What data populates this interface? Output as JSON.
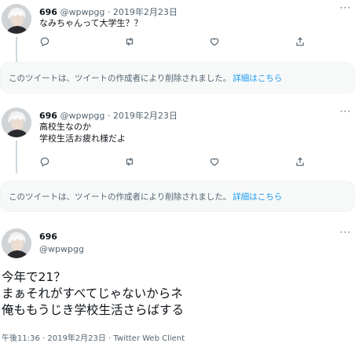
{
  "tweets": [
    {
      "name": "696",
      "handle": "@wpwpgg",
      "dot": "·",
      "date": "2019年2月23日",
      "lines": [
        "なみちゃんって大学生？？"
      ]
    },
    {
      "name": "696",
      "handle": "@wpwpgg",
      "dot": "·",
      "date": "2019年2月23日",
      "lines": [
        "高校生なのか",
        "学校生活お疲れ様だよ"
      ]
    }
  ],
  "deleted_notice": {
    "text": "このツイートは、ツイートの作成者により削除されました。",
    "link": "詳細はこちら"
  },
  "more_glyph": "···",
  "main": {
    "name": "696",
    "handle": "@wpwpgg",
    "lines": [
      "今年で21？",
      "まぁそれがすべてじゃないからネ",
      "俺ももうじき学校生活さらばする"
    ],
    "footer": "午後11:36 · 2019年2月23日 · Twitter Web Client"
  },
  "icons": {
    "reply": "reply-icon",
    "retweet": "retweet-icon",
    "like": "like-icon",
    "share": "share-icon",
    "more": "more-icon",
    "avatar": "avatar-image"
  },
  "colors": {
    "link": "#1d9bf0",
    "muted": "#536471",
    "notice_bg": "#f7f9f9"
  }
}
